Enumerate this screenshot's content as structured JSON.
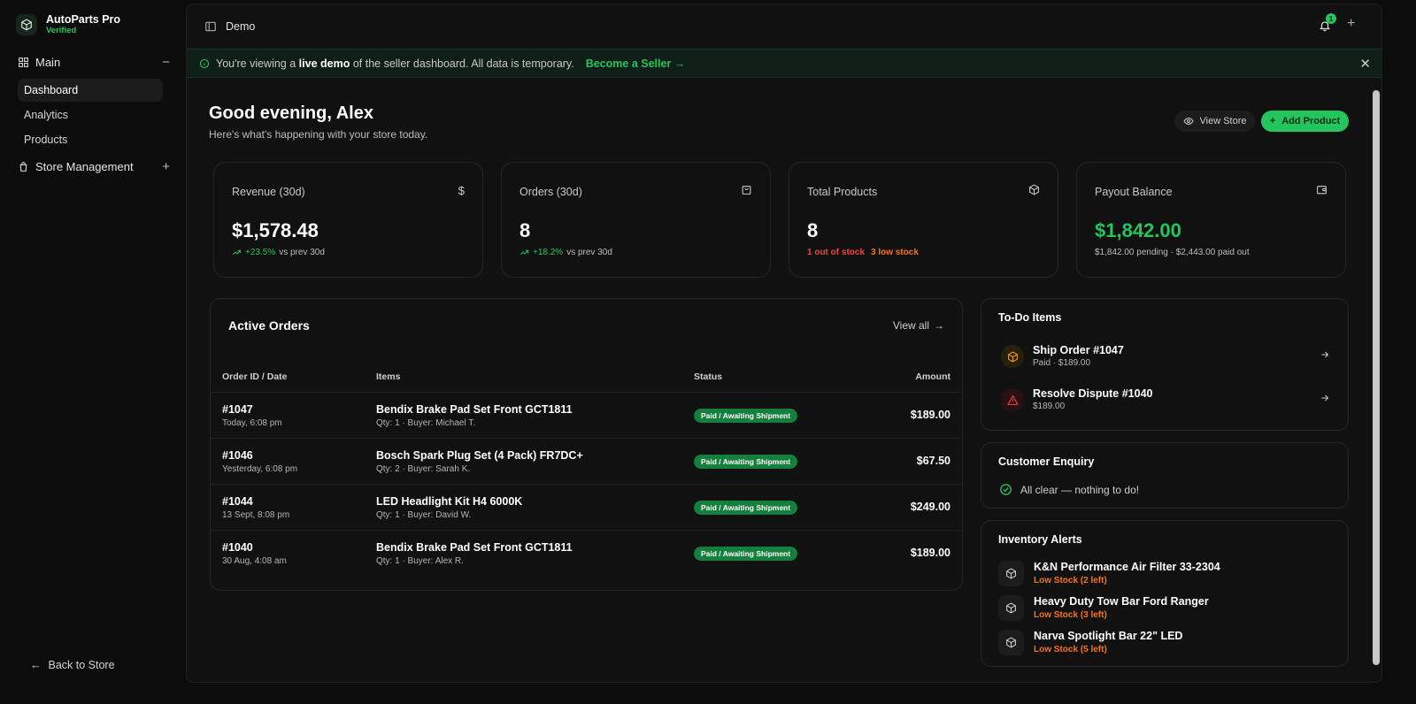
{
  "brand": {
    "name": "AutoParts Pro",
    "status": "Verified"
  },
  "sidebar": {
    "main_group": "Main",
    "items": [
      {
        "label": "Dashboard",
        "active": true
      },
      {
        "label": "Analytics",
        "active": false
      },
      {
        "label": "Products",
        "active": false
      }
    ],
    "store_group": "Store Management",
    "back": "Back to Store"
  },
  "topbar": {
    "breadcrumb": "Demo",
    "notification_count": "1"
  },
  "banner": {
    "prefix": "You're viewing a",
    "bold": "live demo",
    "suffix": "of the seller dashboard. All data is temporary.",
    "link": "Become a Seller →"
  },
  "header": {
    "greeting": "Good evening, Alex",
    "subtitle": "Here's what's happening with your store today.",
    "view_store": "View Store",
    "add_product": "Add Product"
  },
  "stats": [
    {
      "label": "Revenue (30d)",
      "value": "$1,578.48",
      "change": "+23.5%",
      "note": "vs prev 30d",
      "icon": "dollar-icon"
    },
    {
      "label": "Orders (30d)",
      "value": "8",
      "change": "+18.2%",
      "note": "vs prev 30d",
      "icon": "shopping-bag-icon"
    },
    {
      "label": "Total Products",
      "value": "8",
      "out_of_stock": "1 out of stock",
      "low_stock": "3 low stock",
      "icon": "package-icon"
    },
    {
      "label": "Payout Balance",
      "value": "$1,842.00",
      "note": "$1,842.00 pending · $2,443.00 paid out",
      "icon": "wallet-icon"
    }
  ],
  "orders": {
    "title": "Active Orders",
    "view_all": "View all",
    "columns": [
      "Order ID / Date",
      "Items",
      "Status",
      "Amount"
    ],
    "rows": [
      {
        "id": "#1047",
        "date": "Today, 6:08 pm",
        "item": "Bendix Brake Pad Set Front GCT1811",
        "meta": "Qty: 1 · Buyer: Michael T.",
        "status": "Paid / Awaiting Shipment",
        "amount": "$189.00"
      },
      {
        "id": "#1046",
        "date": "Yesterday, 6:08 pm",
        "item": "Bosch Spark Plug Set (4 Pack) FR7DC+",
        "meta": "Qty: 2 · Buyer: Sarah K.",
        "status": "Paid / Awaiting Shipment",
        "amount": "$67.50"
      },
      {
        "id": "#1044",
        "date": "13 Sept, 8:08 pm",
        "item": "LED Headlight Kit H4 6000K",
        "meta": "Qty: 1 · Buyer: David W.",
        "status": "Paid / Awaiting Shipment",
        "amount": "$249.00"
      },
      {
        "id": "#1040",
        "date": "30 Aug, 4:08 am",
        "item": "Bendix Brake Pad Set Front GCT1811",
        "meta": "Qty: 1 · Buyer: Alex R.",
        "status": "Paid / Awaiting Shipment",
        "amount": "$189.00"
      }
    ]
  },
  "todo": {
    "title": "To-Do Items",
    "items": [
      {
        "title": "Ship Order #1047",
        "sub": "Paid · $189.00",
        "icon": "package-icon"
      },
      {
        "title": "Resolve Dispute #1040",
        "sub": "$189.00",
        "icon": "alert-triangle-icon"
      }
    ]
  },
  "enquiry": {
    "title": "Customer Enquiry",
    "message": "All clear — nothing to do!"
  },
  "inventory": {
    "title": "Inventory Alerts",
    "items": [
      {
        "name": "K&N Performance Air Filter 33-2304",
        "stock": "Low Stock (2 left)"
      },
      {
        "name": "Heavy Duty Tow Bar Ford Ranger",
        "stock": "Low Stock (3 left)"
      },
      {
        "name": "Narva Spotlight Bar 22\" LED",
        "stock": "Low Stock (5 left)"
      }
    ]
  },
  "colors": {
    "accent": "#22c55e",
    "danger": "#ef4444",
    "warning": "#f97316",
    "background": "#0c0c0c"
  }
}
